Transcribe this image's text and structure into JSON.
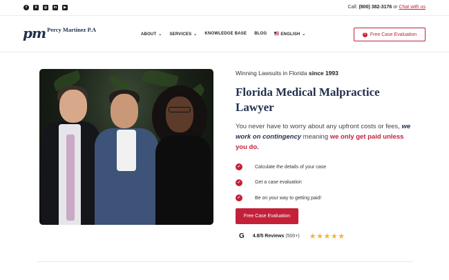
{
  "topbar": {
    "socials": [
      {
        "name": "facebook-icon",
        "glyph": "f"
      },
      {
        "name": "x-icon",
        "glyph": "X"
      },
      {
        "name": "instagram-icon",
        "glyph": "◎"
      },
      {
        "name": "linkedin-icon",
        "glyph": "in"
      },
      {
        "name": "youtube-icon",
        "glyph": "▶"
      }
    ],
    "call_label": "Call:",
    "phone": "(800) 382-3176",
    "or_text": "or",
    "chat_link": "Chat with us"
  },
  "header": {
    "logo_mark": "pm",
    "logo_text": "Percy Martinez P.A",
    "nav": {
      "about": "ABOUT",
      "services": "SERVICES",
      "knowledge_base": "KNOWLEDGE BASE",
      "blog": "BLOG",
      "language": "ENGLISH"
    },
    "cta_label": "Free Case Evaluation",
    "cta_icon": "?"
  },
  "hero": {
    "tagline_prefix": "Winning Lawsuits in Florida",
    "tagline_since": "since 1993",
    "headline": "Florida Medical Malpractice Lawyer",
    "intro_1": "You never have to worry about any upfront costs or fees,",
    "intro_em": "we work on contingency",
    "intro_2": "meaning",
    "intro_red": "we only get paid unless you do.",
    "checklist": [
      "Calculate the details of your case",
      "Get a case evaluation",
      "Be on your way to getting paid!"
    ],
    "cta_label": "Free Case Evaluation",
    "reviews": {
      "google_mark": "G",
      "score": "4.8/5 Reviews",
      "count": "(500+)",
      "stars": "★★★★★"
    }
  },
  "colors": {
    "accent": "#c4203a",
    "navy": "#23304f",
    "star": "#f3b52c"
  }
}
